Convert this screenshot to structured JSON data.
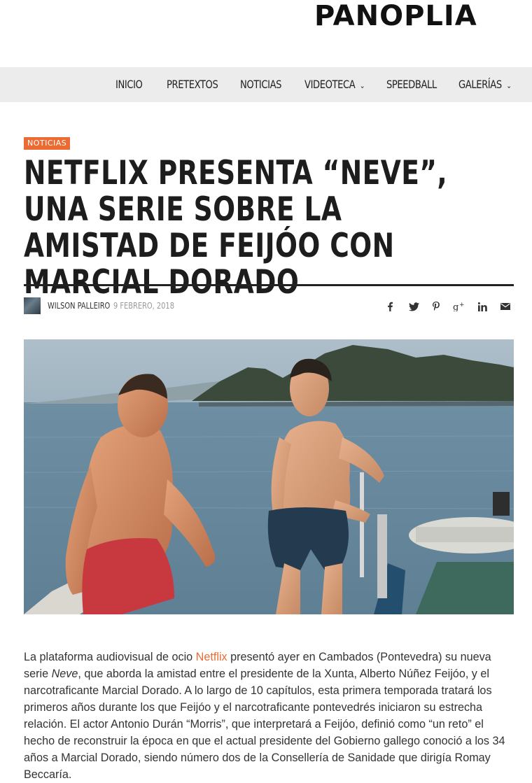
{
  "site": {
    "logo_text": "PANOPLIA"
  },
  "nav": {
    "items": [
      {
        "label": "INICIO",
        "has_dropdown": false
      },
      {
        "label": "PRETEXTOS",
        "has_dropdown": false
      },
      {
        "label": "NOTICIAS",
        "has_dropdown": false
      },
      {
        "label": "VIDEOTECA",
        "has_dropdown": true
      },
      {
        "label": "SPEEDBALL",
        "has_dropdown": false
      },
      {
        "label": "GALERÍAS",
        "has_dropdown": true
      }
    ]
  },
  "article": {
    "category": "NOTICIAS",
    "title": "NETFLIX PRESENTA “NEVE”, UNA SERIE SOBRE LA AMISTAD DE FEIJÓO CON MARCIAL DORADO",
    "author": "WILSON PALLEIRO",
    "date": "9 FEBRERO, 2018",
    "share_icons": [
      "facebook-icon",
      "twitter-icon",
      "pinterest-icon",
      "google-plus-icon",
      "linkedin-icon",
      "email-icon"
    ],
    "body": {
      "before_link": "La plataforma audiovisual de ocio ",
      "link_text": "Netflix",
      "after_link": " presentó ayer en Cambados (Pontevedra) su nueva serie ",
      "series_name": "Neve",
      "rest": ", que aborda la amistad entre el presidente de la Xunta, Alberto Núñez Feijóo, y el narcotraficante Marcial Dorado. A lo largo de 10 capítulos, esta primera temporada tratará los primeros años durante los que Feijóo y el narcotraficante pontevedrés iniciaron su estrecha relación. El actor Antonio Durán “Morris”, que interpretará a Feijóo, definió como “un reto” el hecho de reconstruir la época en que el actual presidente del Gobierno gallego conoció a los 34 años a Marcial Dorado, siendo número dos de la Consellería de Sanidade que dirigía Romay Beccaría."
    }
  },
  "colors": {
    "accent": "#ec6b33",
    "nav_bg": "#ececec",
    "title": "#1d1d1d"
  }
}
